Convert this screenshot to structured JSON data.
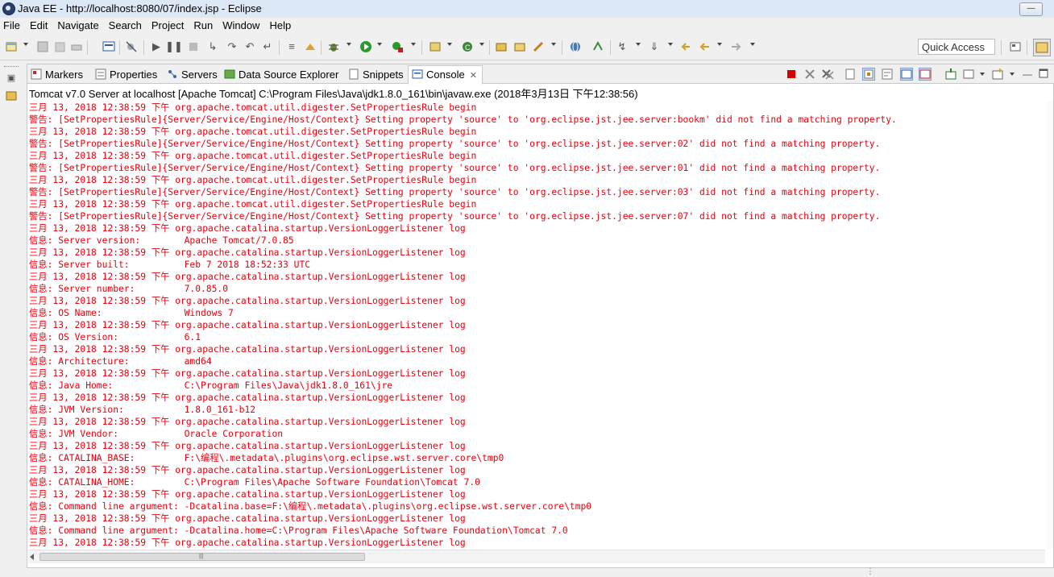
{
  "window": {
    "title": "Java EE - http://localhost:8080/07/index.jsp - Eclipse"
  },
  "menu": [
    "File",
    "Edit",
    "Navigate",
    "Search",
    "Project",
    "Run",
    "Window",
    "Help"
  ],
  "toolbar": {
    "quick_access_placeholder": "Quick Access"
  },
  "tabs": [
    {
      "label": "Markers",
      "icon": "markers-icon"
    },
    {
      "label": "Properties",
      "icon": "properties-icon"
    },
    {
      "label": "Servers",
      "icon": "servers-icon"
    },
    {
      "label": "Data Source Explorer",
      "icon": "data-source-explorer-icon"
    },
    {
      "label": "Snippets",
      "icon": "snippets-icon"
    },
    {
      "label": "Console",
      "icon": "console-icon",
      "active": true
    }
  ],
  "console": {
    "header": "Tomcat v7.0 Server at localhost [Apache Tomcat] C:\\Program Files\\Java\\jdk1.8.0_161\\bin\\javaw.exe (2018年3月13日 下午12:38:56)",
    "lines": [
      "三月 13, 2018 12:38:59 下午 org.apache.tomcat.util.digester.SetPropertiesRule begin",
      "警告: [SetPropertiesRule]{Server/Service/Engine/Host/Context} Setting property 'source' to 'org.eclipse.jst.jee.server:bookm' did not find a matching property.",
      "三月 13, 2018 12:38:59 下午 org.apache.tomcat.util.digester.SetPropertiesRule begin",
      "警告: [SetPropertiesRule]{Server/Service/Engine/Host/Context} Setting property 'source' to 'org.eclipse.jst.jee.server:02' did not find a matching property.",
      "三月 13, 2018 12:38:59 下午 org.apache.tomcat.util.digester.SetPropertiesRule begin",
      "警告: [SetPropertiesRule]{Server/Service/Engine/Host/Context} Setting property 'source' to 'org.eclipse.jst.jee.server:01' did not find a matching property.",
      "三月 13, 2018 12:38:59 下午 org.apache.tomcat.util.digester.SetPropertiesRule begin",
      "警告: [SetPropertiesRule]{Server/Service/Engine/Host/Context} Setting property 'source' to 'org.eclipse.jst.jee.server:03' did not find a matching property.",
      "三月 13, 2018 12:38:59 下午 org.apache.tomcat.util.digester.SetPropertiesRule begin",
      "警告: [SetPropertiesRule]{Server/Service/Engine/Host/Context} Setting property 'source' to 'org.eclipse.jst.jee.server:07' did not find a matching property.",
      "三月 13, 2018 12:38:59 下午 org.apache.catalina.startup.VersionLoggerListener log",
      "信息: Server version:        Apache Tomcat/7.0.85",
      "三月 13, 2018 12:38:59 下午 org.apache.catalina.startup.VersionLoggerListener log",
      "信息: Server built:          Feb 7 2018 18:52:33 UTC",
      "三月 13, 2018 12:38:59 下午 org.apache.catalina.startup.VersionLoggerListener log",
      "信息: Server number:         7.0.85.0",
      "三月 13, 2018 12:38:59 下午 org.apache.catalina.startup.VersionLoggerListener log",
      "信息: OS Name:               Windows 7",
      "三月 13, 2018 12:38:59 下午 org.apache.catalina.startup.VersionLoggerListener log",
      "信息: OS Version:            6.1",
      "三月 13, 2018 12:38:59 下午 org.apache.catalina.startup.VersionLoggerListener log",
      "信息: Architecture:          amd64",
      "三月 13, 2018 12:38:59 下午 org.apache.catalina.startup.VersionLoggerListener log",
      "信息: Java Home:             C:\\Program Files\\Java\\jdk1.8.0_161\\jre",
      "三月 13, 2018 12:38:59 下午 org.apache.catalina.startup.VersionLoggerListener log",
      "信息: JVM Version:           1.8.0_161-b12",
      "三月 13, 2018 12:38:59 下午 org.apache.catalina.startup.VersionLoggerListener log",
      "信息: JVM Vendor:            Oracle Corporation",
      "三月 13, 2018 12:38:59 下午 org.apache.catalina.startup.VersionLoggerListener log",
      "信息: CATALINA_BASE:         F:\\编程\\.metadata\\.plugins\\org.eclipse.wst.server.core\\tmp0",
      "三月 13, 2018 12:38:59 下午 org.apache.catalina.startup.VersionLoggerListener log",
      "信息: CATALINA_HOME:         C:\\Program Files\\Apache Software Foundation\\Tomcat 7.0",
      "三月 13, 2018 12:38:59 下午 org.apache.catalina.startup.VersionLoggerListener log",
      "信息: Command line argument: -Dcatalina.base=F:\\编程\\.metadata\\.plugins\\org.eclipse.wst.server.core\\tmp0",
      "三月 13, 2018 12:38:59 下午 org.apache.catalina.startup.VersionLoggerListener log",
      "信息: Command line argument: -Dcatalina.home=C:\\Program Files\\Apache Software Foundation\\Tomcat 7.0",
      "三月 13, 2018 12:38:59 下午 org.apache.catalina.startup.VersionLoggerListener log"
    ]
  },
  "colors": {
    "console_error_text": "#e8000e",
    "titlebar_bg": "#dce8f5",
    "terminate_red": "#d40000"
  }
}
